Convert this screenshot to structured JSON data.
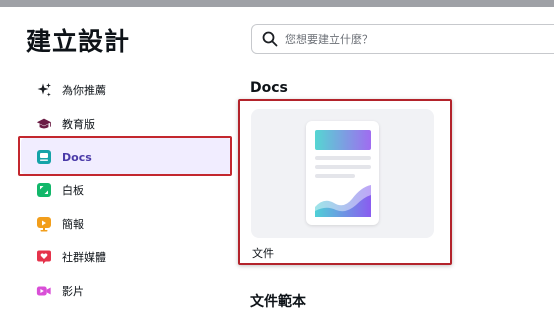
{
  "dialog": {
    "title": "建立設計",
    "search": {
      "placeholder": "您想要建立什麼？",
      "value": ""
    }
  },
  "sidebar": {
    "items": [
      {
        "label": "為你推薦",
        "icon": "sparkle-icon",
        "color": "#1c1f24"
      },
      {
        "label": "教育版",
        "icon": "graduation-cap-icon",
        "color": "#6b1d45"
      },
      {
        "label": "Docs",
        "icon": "docs-icon",
        "color": "#15a3a8",
        "active": true
      },
      {
        "label": "白板",
        "icon": "whiteboard-icon",
        "color": "#12b76a"
      },
      {
        "label": "簡報",
        "icon": "presentation-icon",
        "color": "#f29e1b"
      },
      {
        "label": "社群媒體",
        "icon": "social-heart-icon",
        "color": "#e5334b"
      },
      {
        "label": "影片",
        "icon": "video-icon",
        "color": "#d94fd7"
      }
    ]
  },
  "main": {
    "section_docs": "Docs",
    "card": {
      "caption": "文件"
    },
    "section_templates": "文件範本"
  },
  "colors": {
    "accent_bg": "#f1edff",
    "highlight_border": "#c3272e"
  }
}
